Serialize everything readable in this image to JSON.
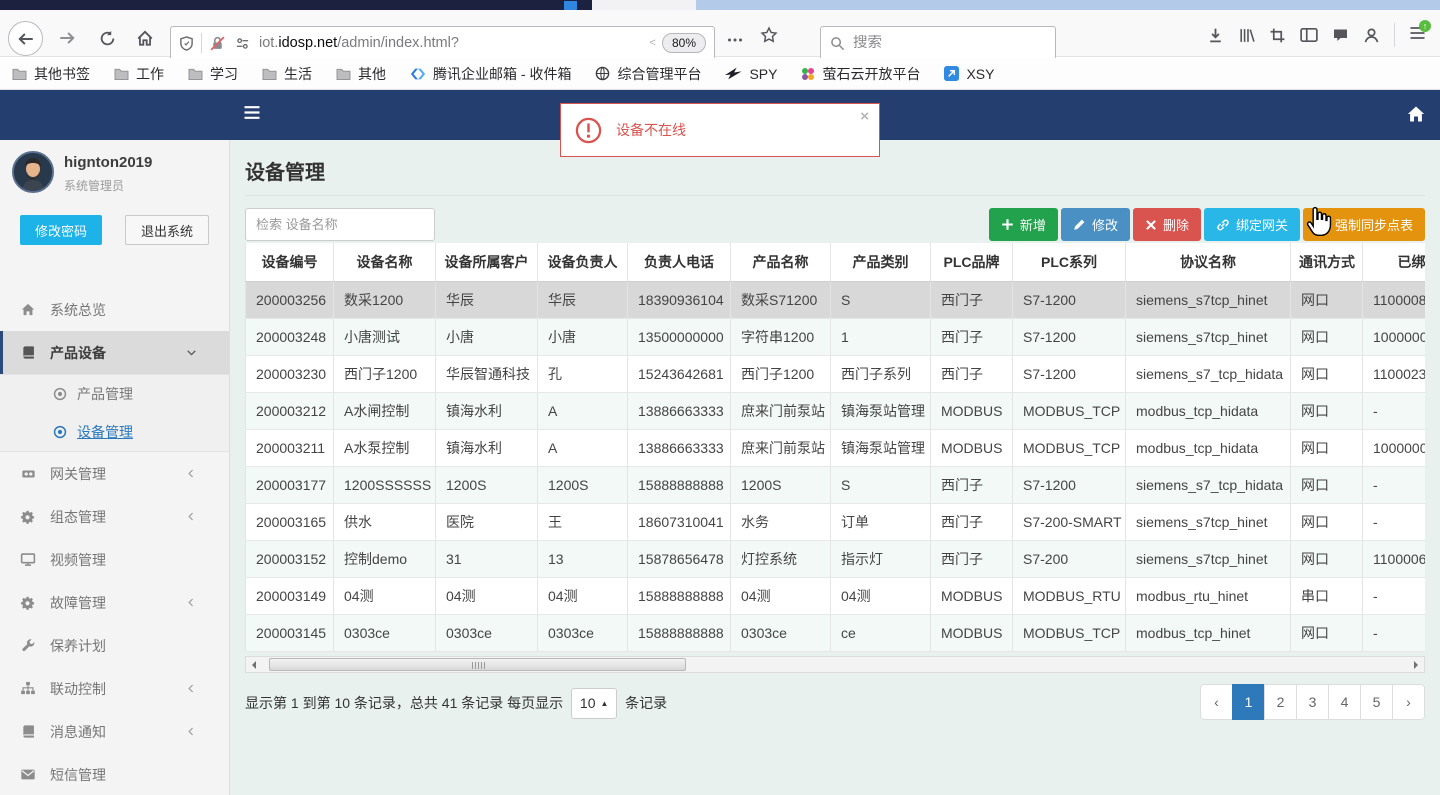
{
  "browser": {
    "nav_icons": [
      "back",
      "forward",
      "reload",
      "home"
    ],
    "urlbar_icons": [
      "shield",
      "blocked",
      "permissions"
    ],
    "url": {
      "prefix": "iot.",
      "domain": "idosp.net",
      "path": "/admin/index.html?",
      "trunc": "<",
      "zoom": "80%"
    },
    "page_action_icons": [
      "dots",
      "star"
    ],
    "search_placeholder": "搜索",
    "right_icons": [
      "download",
      "library",
      "screenshot",
      "sidebars",
      "chat",
      "account"
    ],
    "menu_icon": "hamburger",
    "bookmarks": [
      {
        "icon": "folder",
        "label": "其他书签"
      },
      {
        "icon": "folder",
        "label": "工作"
      },
      {
        "icon": "folder",
        "label": "学习"
      },
      {
        "icon": "folder",
        "label": "生活"
      },
      {
        "icon": "folder",
        "label": "其他"
      },
      {
        "icon": "tencent",
        "label": "腾讯企业邮箱 - 收件箱"
      },
      {
        "icon": "globe",
        "label": "综合管理平台"
      },
      {
        "icon": "spy",
        "label": "SPY"
      },
      {
        "icon": "ezviz",
        "label": "萤石云开放平台"
      },
      {
        "icon": "xsy",
        "label": "XSY"
      }
    ]
  },
  "navbar": {
    "menu_icon": "nav-menu",
    "home_icon": "nav-home"
  },
  "alert": {
    "icon": "alert-exclaim",
    "text": "设备不在线",
    "close": "×"
  },
  "sidebar": {
    "username": "hignton2019",
    "role": "系统管理员",
    "change_password_label": "修改密码",
    "logout_label": "退出系统",
    "menu": [
      {
        "icon": "s-home",
        "label": "系统总览"
      },
      {
        "icon": "s-book",
        "label": "产品设备",
        "chevron": "down",
        "active": true,
        "children": [
          {
            "icon": "s-bullseye",
            "label": "产品管理",
            "active": false
          },
          {
            "icon": "s-bullseye",
            "label": "设备管理",
            "active": true
          }
        ]
      },
      {
        "icon": "s-gateway",
        "label": "网关管理",
        "chevron": "left"
      },
      {
        "icon": "s-gear",
        "label": "组态管理",
        "chevron": "left"
      },
      {
        "icon": "s-monitor",
        "label": "视频管理"
      },
      {
        "icon": "s-gear",
        "label": "故障管理",
        "chevron": "left"
      },
      {
        "icon": "s-wrench",
        "label": "保养计划"
      },
      {
        "icon": "s-sitemap",
        "label": "联动控制",
        "chevron": "left"
      },
      {
        "icon": "s-book",
        "label": "消息通知",
        "chevron": "left"
      },
      {
        "icon": "s-envelope",
        "label": "短信管理"
      }
    ]
  },
  "main": {
    "title": "设备管理",
    "search_placeholder": "检索 设备名称",
    "actions": [
      {
        "icon": "a-plus",
        "label": "新增",
        "color": "#23a24d"
      },
      {
        "icon": "a-pencil",
        "label": "修改",
        "color": "#4a90c2"
      },
      {
        "icon": "a-cross",
        "label": "删除",
        "color": "#d9534f"
      },
      {
        "icon": "a-link",
        "label": "绑定网关",
        "color": "#29b7e8"
      },
      {
        "icon": "a-refresh",
        "label": "强制同步点表",
        "color": "#e4930e"
      }
    ],
    "table": {
      "headers": [
        "设备编号",
        "设备名称",
        "设备所属客户",
        "设备负责人",
        "负责人电话",
        "产品名称",
        "产品类别",
        "PLC品牌",
        "PLC系列",
        "协议名称",
        "通讯方式",
        "已绑定网关"
      ],
      "selected_row": 0,
      "rows": [
        [
          "200003256",
          "数采1200",
          "华辰",
          "华辰",
          "18390936104",
          "数采S71200",
          "S",
          "西门子",
          "S7-1200",
          "siemens_s7tcp_hinet",
          "网口",
          "1100008"
        ],
        [
          "200003248",
          "小唐测试",
          "小唐",
          "小唐",
          "13500000000",
          "字符串1200",
          "1",
          "西门子",
          "S7-1200",
          "siemens_s7tcp_hinet",
          "网口",
          "1000000"
        ],
        [
          "200003230",
          "西门子1200",
          "华辰智通科技",
          "孔",
          "15243642681",
          "西门子1200",
          "西门子系列",
          "西门子",
          "S7-1200",
          "siemens_s7_tcp_hidata",
          "网口",
          "1100023"
        ],
        [
          "200003212",
          "A水闸控制",
          "镇海水利",
          "A",
          "13886663333",
          "庶来门前泵站",
          "镇海泵站管理",
          "MODBUS",
          "MODBUS_TCP",
          "modbus_tcp_hidata",
          "网口",
          "-"
        ],
        [
          "200003211",
          "A水泵控制",
          "镇海水利",
          "A",
          "13886663333",
          "庶来门前泵站",
          "镇海泵站管理",
          "MODBUS",
          "MODBUS_TCP",
          "modbus_tcp_hidata",
          "网口",
          "1000000"
        ],
        [
          "200003177",
          "1200SSSSSS",
          "1200S",
          "1200S",
          "15888888888",
          "1200S",
          "S",
          "西门子",
          "S7-1200",
          "siemens_s7_tcp_hidata",
          "网口",
          "-"
        ],
        [
          "200003165",
          "供水",
          "医院",
          "王",
          "18607310041",
          "水务",
          "订单",
          "西门子",
          "S7-200-SMART",
          "siemens_s7tcp_hinet",
          "网口",
          "-"
        ],
        [
          "200003152",
          "控制demo",
          "31",
          "13",
          "15878656478",
          "灯控系统",
          "指示灯",
          "西门子",
          "S7-200",
          "siemens_s7tcp_hinet",
          "网口",
          "1100006"
        ],
        [
          "200003149",
          "04测",
          "04测",
          "04测",
          "15888888888",
          "04测",
          "04测",
          "MODBUS",
          "MODBUS_RTU",
          "modbus_rtu_hinet",
          "串口",
          "-"
        ],
        [
          "200003145",
          "0303ce",
          "0303ce",
          "0303ce",
          "15888888888",
          "0303ce",
          "ce",
          "MODBUS",
          "MODBUS_TCP",
          "modbus_tcp_hinet",
          "网口",
          "-"
        ]
      ]
    },
    "pagination": {
      "info_prefix": "显示第 1 到第 10 条记录，总共 41 条记录 每页显示",
      "page_size": "10",
      "info_suffix": "条记录",
      "prev_label": "‹",
      "next_label": "›",
      "pages": [
        "1",
        "2",
        "3",
        "4",
        "5"
      ],
      "active_page": "1"
    }
  }
}
